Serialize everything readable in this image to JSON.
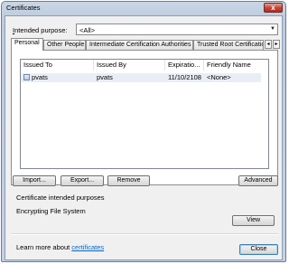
{
  "window": {
    "title": "Certificates",
    "close_glyph": "x"
  },
  "purpose": {
    "label_prefix": "I",
    "label_rest": "ntended purpose:",
    "value": "<All>"
  },
  "tabs": [
    {
      "label": "Personal"
    },
    {
      "label": "Other People"
    },
    {
      "label": "Intermediate Certification Authorities"
    },
    {
      "label": "Trusted Root Certification"
    }
  ],
  "tab_scroll": {
    "left": "◂",
    "right": "▸"
  },
  "list": {
    "headers": [
      "Issued To",
      "Issued By",
      "Expiratio...",
      "Friendly Name"
    ],
    "rows": [
      {
        "issued_to": "pvats",
        "issued_by": "pvats",
        "expiration": "11/10/2108",
        "friendly_name": "<None>"
      }
    ]
  },
  "buttons": {
    "import": "Import...",
    "export": "Export...",
    "remove": "Remove",
    "advanced": "Advanced",
    "view": "View",
    "close": "Close"
  },
  "purposes": {
    "heading": "Certificate intended purposes",
    "value": "Encrypting File System"
  },
  "footer": {
    "learn_prefix": "Learn more about ",
    "learn_link": "certificates"
  }
}
